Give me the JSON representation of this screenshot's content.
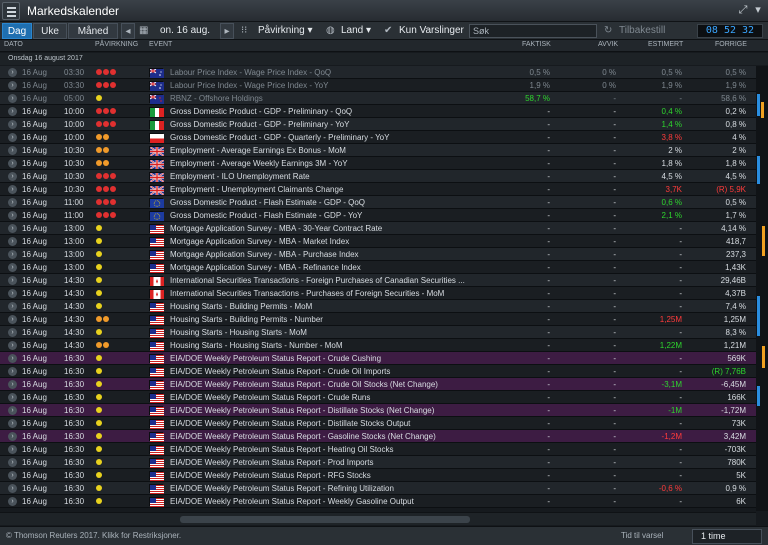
{
  "app": {
    "title": "Markedskalender"
  },
  "colors": {
    "accent": "#1f6fb0",
    "positive": "#2ed52e",
    "negative": "#ff3b3b",
    "highlight_row": "#3d1c43",
    "clock": "#3aa6ff",
    "importance_high": "#e03030",
    "importance_medium": "#f09a2a",
    "importance_low": "#e8d21e"
  },
  "toolbar": {
    "tabs": [
      {
        "label": "Dag",
        "active": true
      },
      {
        "label": "Uke",
        "active": false
      },
      {
        "label": "Måned",
        "active": false
      }
    ],
    "date_label": "on. 16 aug.",
    "impact_label": "Påvirkning",
    "country_label": "Land",
    "alerts_label": "Kun Varslinger",
    "search_placeholder": "Søk",
    "back_label": "Tilbakestill",
    "clock": "08 52 32"
  },
  "columns": {
    "date": "DATO",
    "impact": "PÅVIRKNING",
    "event": "EVENT",
    "actual": "FAKTISK",
    "deviation": "AVVIK",
    "estimate": "ESTIMERT",
    "previous": "FORRIGE"
  },
  "date_group": "Onsdag 16 august 2017",
  "rows": [
    {
      "date": "16 Aug",
      "time": "03:30",
      "impact": "high",
      "flag": "au",
      "event": "Labour Price Index - Wage Price Index - QoQ",
      "actual": "0,5 %",
      "deviation": "0 %",
      "estimate": "0,5 %",
      "previous": "0,5 %",
      "past": true
    },
    {
      "date": "16 Aug",
      "time": "03:30",
      "impact": "high",
      "flag": "au",
      "event": "Labour Price Index - Wage Price Index - YoY",
      "actual": "1,9 %",
      "deviation": "0 %",
      "estimate": "1,9 %",
      "previous": "1,9 %",
      "past": true
    },
    {
      "date": "16 Aug",
      "time": "05:00",
      "impact": "low",
      "flag": "nz",
      "event": "RBNZ - Offshore Holdings",
      "actual": "58,7 %",
      "actual_color": "green",
      "deviation": "-",
      "estimate": "-",
      "previous": "58,6 %",
      "past": true
    },
    {
      "date": "16 Aug",
      "time": "10:00",
      "impact": "high",
      "flag": "it",
      "event": "Gross Domestic Product - GDP - Preliminary - QoQ",
      "actual": "-",
      "deviation": "-",
      "estimate": "0,4 %",
      "estimate_color": "green",
      "previous": "0,2 %"
    },
    {
      "date": "16 Aug",
      "time": "10:00",
      "impact": "high",
      "flag": "it",
      "event": "Gross Domestic Product - GDP - Preliminary - YoY",
      "actual": "-",
      "deviation": "-",
      "estimate": "1,4 %",
      "estimate_color": "green",
      "previous": "0,8 %"
    },
    {
      "date": "16 Aug",
      "time": "10:00",
      "impact": "medium",
      "flag": "pl",
      "event": "Gross Domestic Product - GDP - Quarterly - Preliminary - YoY",
      "actual": "-",
      "deviation": "-",
      "estimate": "3,8 %",
      "estimate_color": "red",
      "previous": "4 %"
    },
    {
      "date": "16 Aug",
      "time": "10:30",
      "impact": "medium",
      "flag": "gb",
      "event": "Employment - Average Earnings Ex Bonus - MoM",
      "actual": "-",
      "deviation": "-",
      "estimate": "2 %",
      "previous": "2 %"
    },
    {
      "date": "16 Aug",
      "time": "10:30",
      "impact": "medium",
      "flag": "gb",
      "event": "Employment - Average Weekly Earnings 3M - YoY",
      "actual": "-",
      "deviation": "-",
      "estimate": "1,8 %",
      "previous": "1,8 %"
    },
    {
      "date": "16 Aug",
      "time": "10:30",
      "impact": "high",
      "flag": "gb",
      "event": "Employment - ILO Unemployment Rate",
      "actual": "-",
      "deviation": "-",
      "estimate": "4,5 %",
      "previous": "4,5 %"
    },
    {
      "date": "16 Aug",
      "time": "10:30",
      "impact": "high",
      "flag": "gb",
      "event": "Employment - Unemployment Claimants Change",
      "actual": "-",
      "deviation": "-",
      "estimate": "3,7K",
      "estimate_color": "red",
      "previous": "(R) 5,9K",
      "previous_color": "red"
    },
    {
      "date": "16 Aug",
      "time": "11:00",
      "impact": "high",
      "flag": "eu",
      "event": "Gross Domestic Product - Flash Estimate - GDP - QoQ",
      "actual": "-",
      "deviation": "-",
      "estimate": "0,6 %",
      "estimate_color": "green",
      "previous": "0,5 %"
    },
    {
      "date": "16 Aug",
      "time": "11:00",
      "impact": "high",
      "flag": "eu",
      "event": "Gross Domestic Product - Flash Estimate - GDP - YoY",
      "actual": "-",
      "deviation": "-",
      "estimate": "2,1 %",
      "estimate_color": "green",
      "previous": "1,7 %"
    },
    {
      "date": "16 Aug",
      "time": "13:00",
      "impact": "low",
      "flag": "us",
      "event": "Mortgage Application Survey - MBA - 30-Year Contract Rate",
      "actual": "-",
      "deviation": "-",
      "estimate": "-",
      "previous": "4,14 %"
    },
    {
      "date": "16 Aug",
      "time": "13:00",
      "impact": "low",
      "flag": "us",
      "event": "Mortgage Application Survey - MBA - Market Index",
      "actual": "-",
      "deviation": "-",
      "estimate": "-",
      "previous": "418,7"
    },
    {
      "date": "16 Aug",
      "time": "13:00",
      "impact": "low",
      "flag": "us",
      "event": "Mortgage Application Survey - MBA - Purchase Index",
      "actual": "-",
      "deviation": "-",
      "estimate": "-",
      "previous": "237,3"
    },
    {
      "date": "16 Aug",
      "time": "13:00",
      "impact": "low",
      "flag": "us",
      "event": "Mortgage Application Survey - MBA - Refinance Index",
      "actual": "-",
      "deviation": "-",
      "estimate": "-",
      "previous": "1,43K"
    },
    {
      "date": "16 Aug",
      "time": "14:30",
      "impact": "low",
      "flag": "ca",
      "event": "International Securities Transactions - Foreign Purchases of Canadian Securities ...",
      "actual": "-",
      "deviation": "-",
      "estimate": "-",
      "previous": "29,46B"
    },
    {
      "date": "16 Aug",
      "time": "14:30",
      "impact": "low",
      "flag": "ca",
      "event": "International Securities Transactions - Purchases of Foreign Securities - MoM",
      "actual": "-",
      "deviation": "-",
      "estimate": "-",
      "previous": "4,37B"
    },
    {
      "date": "16 Aug",
      "time": "14:30",
      "impact": "low",
      "flag": "us",
      "event": "Housing Starts - Building Permits - MoM",
      "actual": "-",
      "deviation": "-",
      "estimate": "-",
      "previous": "7,4 %"
    },
    {
      "date": "16 Aug",
      "time": "14:30",
      "impact": "medium",
      "flag": "us",
      "event": "Housing Starts - Building Permits - Number",
      "actual": "-",
      "deviation": "-",
      "estimate": "1,25M",
      "estimate_color": "red",
      "previous": "1,25M"
    },
    {
      "date": "16 Aug",
      "time": "14:30",
      "impact": "low",
      "flag": "us",
      "event": "Housing Starts - Housing Starts - MoM",
      "actual": "-",
      "deviation": "-",
      "estimate": "-",
      "previous": "8,3 %"
    },
    {
      "date": "16 Aug",
      "time": "14:30",
      "impact": "medium",
      "flag": "us",
      "event": "Housing Starts - Housing Starts - Number - MoM",
      "actual": "-",
      "deviation": "-",
      "estimate": "1,22M",
      "estimate_color": "green",
      "previous": "1,21M"
    },
    {
      "date": "16 Aug",
      "time": "16:30",
      "impact": "low",
      "flag": "us",
      "event": "EIA/DOE Weekly Petroleum Status Report - Crude Cushing",
      "actual": "-",
      "deviation": "-",
      "estimate": "-",
      "previous": "569K",
      "highlight": true
    },
    {
      "date": "16 Aug",
      "time": "16:30",
      "impact": "low",
      "flag": "us",
      "event": "EIA/DOE Weekly Petroleum Status Report - Crude Oil Imports",
      "actual": "-",
      "deviation": "-",
      "estimate": "-",
      "previous": "(R) 7,76B",
      "previous_color": "green"
    },
    {
      "date": "16 Aug",
      "time": "16:30",
      "impact": "low",
      "flag": "us",
      "event": "EIA/DOE Weekly Petroleum Status Report - Crude Oil Stocks (Net Change)",
      "actual": "-",
      "deviation": "-",
      "estimate": "-3,1M",
      "estimate_color": "green",
      "previous": "-6,45M",
      "highlight": true
    },
    {
      "date": "16 Aug",
      "time": "16:30",
      "impact": "low",
      "flag": "us",
      "event": "EIA/DOE Weekly Petroleum Status Report - Crude Runs",
      "actual": "-",
      "deviation": "-",
      "estimate": "-",
      "previous": "166K"
    },
    {
      "date": "16 Aug",
      "time": "16:30",
      "impact": "low",
      "flag": "us",
      "event": "EIA/DOE Weekly Petroleum Status Report - Distillate Stocks (Net Change)",
      "actual": "-",
      "deviation": "-",
      "estimate": "-1M",
      "estimate_color": "green",
      "previous": "-1,72M",
      "highlight": true
    },
    {
      "date": "16 Aug",
      "time": "16:30",
      "impact": "low",
      "flag": "us",
      "event": "EIA/DOE Weekly Petroleum Status Report - Distillate Stocks Output",
      "actual": "-",
      "deviation": "-",
      "estimate": "-",
      "previous": "73K"
    },
    {
      "date": "16 Aug",
      "time": "16:30",
      "impact": "low",
      "flag": "us",
      "event": "EIA/DOE Weekly Petroleum Status Report - Gasoline Stocks (Net Change)",
      "actual": "-",
      "deviation": "-",
      "estimate": "-1,2M",
      "estimate_color": "red",
      "previous": "3,42M",
      "highlight": true
    },
    {
      "date": "16 Aug",
      "time": "16:30",
      "impact": "low",
      "flag": "us",
      "event": "EIA/DOE Weekly Petroleum Status Report - Heating Oil Stocks",
      "actual": "-",
      "deviation": "-",
      "estimate": "-",
      "previous": "-703K"
    },
    {
      "date": "16 Aug",
      "time": "16:30",
      "impact": "low",
      "flag": "us",
      "event": "EIA/DOE Weekly Petroleum Status Report - Prod Imports",
      "actual": "-",
      "deviation": "-",
      "estimate": "-",
      "previous": "780K"
    },
    {
      "date": "16 Aug",
      "time": "16:30",
      "impact": "low",
      "flag": "us",
      "event": "EIA/DOE Weekly Petroleum Status Report - RFG Stocks",
      "actual": "-",
      "deviation": "-",
      "estimate": "-",
      "previous": "5K"
    },
    {
      "date": "16 Aug",
      "time": "16:30",
      "impact": "low",
      "flag": "us",
      "event": "EIA/DOE Weekly Petroleum Status Report - Refining Utilization",
      "actual": "-",
      "deviation": "-",
      "estimate": "-0,6 %",
      "estimate_color": "red",
      "previous": "0,9 %"
    },
    {
      "date": "16 Aug",
      "time": "16:30",
      "impact": "low",
      "flag": "us",
      "event": "EIA/DOE Weekly Petroleum Status Report - Weekly Gasoline Output",
      "actual": "-",
      "deviation": "-",
      "estimate": "-",
      "previous": "6K"
    }
  ],
  "status": {
    "copyright": "© Thomson Reuters 2017. Klikk for Restriksjoner.",
    "notice_label": "Tid til varsel",
    "notice_value": "1 time"
  }
}
